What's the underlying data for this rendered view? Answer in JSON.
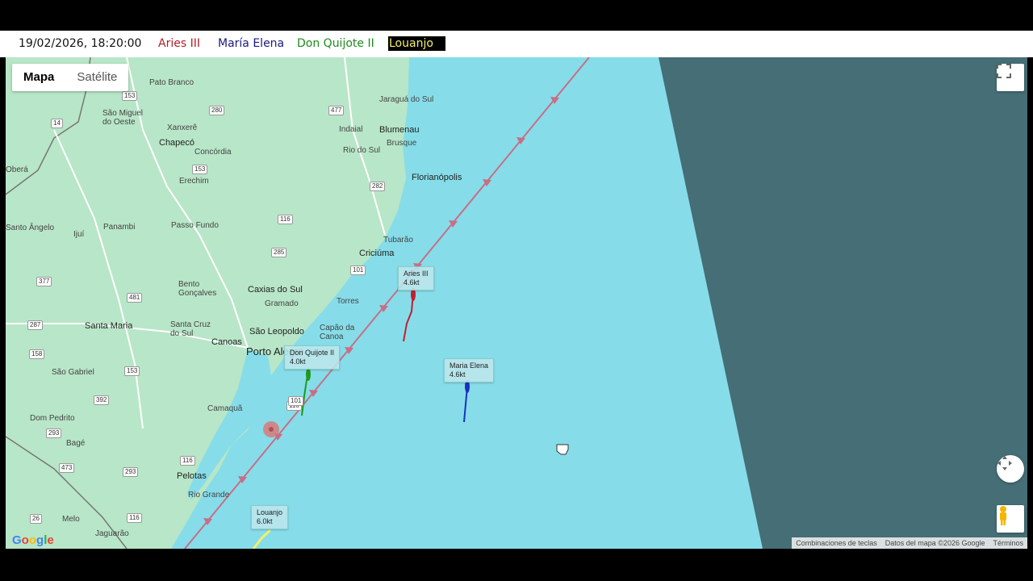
{
  "header": {
    "timestamp": "19/02/2026, 18:20:00",
    "boats": [
      {
        "name": "Aries III",
        "color": "#b0202a"
      },
      {
        "name": "María Elena",
        "color": "#1a1a80"
      },
      {
        "name": "Don Quijote II",
        "color": "#1e8a1e"
      },
      {
        "name": "Louanjo",
        "color": "#f4f06a",
        "bg": "#000"
      }
    ]
  },
  "map": {
    "type_control": {
      "map": "Mapa",
      "satellite": "Satélite"
    },
    "cities": [
      "Pato Branco",
      "São Miguel do Oeste",
      "Xanxerê",
      "Chapecó",
      "Concórdia",
      "Erechim",
      "Panambi",
      "Passo Fundo",
      "Santo Ângelo",
      "Ijuí",
      "Bento Gonçalves",
      "Caxias do Sul",
      "Gramado",
      "Santa Maria",
      "Santa Cruz do Sul",
      "São Leopoldo",
      "Canoas",
      "Porto Alegre",
      "Capão da Canoa",
      "Torres",
      "São Gabriel",
      "Dom Pedrito",
      "Bagé",
      "Camaquã",
      "Pelotas",
      "Rio Grande",
      "Melo",
      "Jaguarão",
      "Jaraguá do Sul",
      "Indaial",
      "Blumenau",
      "Brusque",
      "Rio do Sul",
      "Florianópolis",
      "Tubarão",
      "Criciúma",
      "Oberá"
    ],
    "roads": [
      "153",
      "14",
      "280",
      "477",
      "153",
      "282",
      "116",
      "285",
      "101",
      "377",
      "481",
      "287",
      "158",
      "153",
      "392",
      "116",
      "101",
      "293",
      "473",
      "293",
      "116",
      "26",
      "116"
    ],
    "boat_labels": [
      {
        "name": "Aries III",
        "speed": "4.6kt"
      },
      {
        "name": "Maria Elena",
        "speed": "4.6kt"
      },
      {
        "name": "Don Quijote II",
        "speed": "4.0kt"
      },
      {
        "name": "Louanjo",
        "speed": "6.0kt"
      }
    ],
    "footer": {
      "shortcuts": "Combinaciones de teclas",
      "data": "Datos del mapa ©2026 Google",
      "terms": "Términos"
    },
    "logo": "Google",
    "icons": [
      "fullscreen-icon",
      "camera-control-icon",
      "pegman-icon",
      "grab-hand-icon",
      "location-pin-icon"
    ]
  }
}
